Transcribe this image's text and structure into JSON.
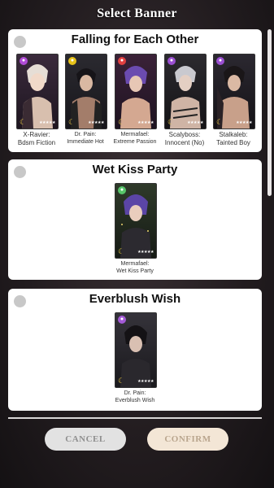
{
  "dialog": {
    "title": "Select Banner"
  },
  "banners": [
    {
      "title": "Falling for Each Other",
      "characters": [
        {
          "caption_line1": "X-Ravier:",
          "caption_line2": "Bdsm Fiction",
          "element_color": "#b04bd6",
          "rarity": "★★★★★"
        },
        {
          "caption_line1": "Dr. Pain:",
          "caption_line2": "Immediate Hot",
          "element_color": "#e7c21a",
          "rarity": "★★★★★"
        },
        {
          "caption_line1": "Mermafael:",
          "caption_line2": "Extreme Passion",
          "element_color": "#e04040",
          "rarity": "★★★★★"
        },
        {
          "caption_line1": "Scalyboss:",
          "caption_line2": "Innocent (No)",
          "element_color": "#9a4fd1",
          "rarity": "★★★★★"
        },
        {
          "caption_line1": "Stalkaleb:",
          "caption_line2": "Tainted Boy",
          "element_color": "#9a4fd1",
          "rarity": "★★★★★"
        }
      ]
    },
    {
      "title": "Wet Kiss Party",
      "characters": [
        {
          "caption_line1": "Mermafael:",
          "caption_line2": "Wet Kiss Party",
          "element_color": "#57c46a",
          "rarity": "★★★★★"
        }
      ]
    },
    {
      "title": "Everblush Wish",
      "characters": [
        {
          "caption_line1": "Dr. Pain:",
          "caption_line2": "Everblush Wish",
          "element_color": "#a35ad6",
          "rarity": "★★★★★"
        }
      ]
    }
  ],
  "actions": {
    "cancel_label": "CANCEL",
    "confirm_label": "CONFIRM"
  },
  "icons": {
    "moon": "crescent-moon-icon",
    "element": "element-badge-icon",
    "radio": "radio-button-icon"
  }
}
